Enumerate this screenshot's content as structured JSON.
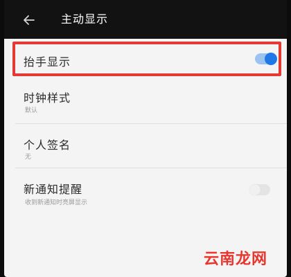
{
  "header": {
    "title": "主动显示"
  },
  "items": [
    {
      "label": "抬手显示",
      "toggle": "on"
    },
    {
      "label": "时钟样式",
      "sub": "默认"
    },
    {
      "label": "个人签名",
      "sub": "无"
    },
    {
      "label": "新通知提醒",
      "sub": "收到新通知时亮屏显示",
      "toggle": "off"
    }
  ],
  "watermark": "云南龙网",
  "colors": {
    "header_bg": "#121212",
    "content_bg": "#f4f4f4",
    "accent": "#1f78e6",
    "highlight": "#e53935"
  }
}
